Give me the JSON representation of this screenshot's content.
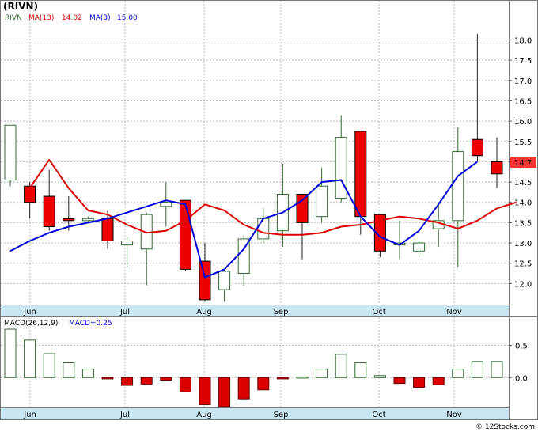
{
  "title": "(RIVN)",
  "legend": {
    "symbol": "RIVN",
    "ma13_label": "MA(13)",
    "ma13_value": "14.02",
    "ma3_label": "MA(3)",
    "ma3_value": "15.00"
  },
  "last_price_tag": "14.7",
  "macd_label": "MACD(26,12,9)",
  "macd_value_label": "MACD=0.25",
  "watermark": "© 12Stocks.com",
  "colors": {
    "up_body": "#ffffff",
    "up_edge": "#2f6a2f",
    "down_body": "#ee0000",
    "down_edge": "#000000",
    "ma13": "#dd0000",
    "ma3": "#0000dd",
    "axis_band": "#c9e6f3",
    "price_tag": "#ff3333",
    "macd_pos_edge": "#2f6a2f",
    "macd_neg_fill": "#dd0000"
  },
  "chart_data": [
    {
      "type": "candlestick",
      "months": [
        "Jun",
        "Jul",
        "Aug",
        "Sep",
        "Oct",
        "Nov"
      ],
      "y_ticks": [
        "12.0",
        "12.5",
        "13.0",
        "13.5",
        "14.0",
        "14.5",
        "15.0",
        "15.5",
        "16.0",
        "16.5",
        "17.0",
        "17.5",
        "18.0"
      ],
      "ylim": [
        11.5,
        18.4
      ],
      "grid": true,
      "candles": [
        {
          "o": 14.55,
          "h": 15.9,
          "l": 14.4,
          "c": 15.9
        },
        {
          "o": 14.4,
          "h": 14.5,
          "l": 13.6,
          "c": 14.0
        },
        {
          "o": 14.15,
          "h": 14.8,
          "l": 13.3,
          "c": 13.4
        },
        {
          "o": 13.6,
          "h": 14.15,
          "l": 13.3,
          "c": 13.55
        },
        {
          "o": 13.55,
          "h": 13.65,
          "l": 13.5,
          "c": 13.6
        },
        {
          "o": 13.6,
          "h": 13.8,
          "l": 12.85,
          "c": 13.05
        },
        {
          "o": 12.95,
          "h": 13.15,
          "l": 12.4,
          "c": 13.05
        },
        {
          "o": 12.85,
          "h": 13.75,
          "l": 11.95,
          "c": 13.7
        },
        {
          "o": 13.9,
          "h": 14.5,
          "l": 13.4,
          "c": 14.0
        },
        {
          "o": 14.05,
          "h": 14.05,
          "l": 12.3,
          "c": 12.35
        },
        {
          "o": 12.55,
          "h": 13.0,
          "l": 11.55,
          "c": 11.6
        },
        {
          "o": 11.85,
          "h": 12.35,
          "l": 11.55,
          "c": 12.3
        },
        {
          "o": 12.25,
          "h": 13.2,
          "l": 11.95,
          "c": 13.1
        },
        {
          "o": 13.1,
          "h": 13.85,
          "l": 13.0,
          "c": 13.6
        },
        {
          "o": 13.3,
          "h": 14.95,
          "l": 12.9,
          "c": 14.2
        },
        {
          "o": 14.2,
          "h": 14.2,
          "l": 12.6,
          "c": 13.5
        },
        {
          "o": 13.65,
          "h": 14.85,
          "l": 13.5,
          "c": 14.4
        },
        {
          "o": 14.1,
          "h": 16.15,
          "l": 14.0,
          "c": 15.6
        },
        {
          "o": 15.75,
          "h": 15.75,
          "l": 13.2,
          "c": 13.65
        },
        {
          "o": 13.7,
          "h": 13.7,
          "l": 12.65,
          "c": 12.8
        },
        {
          "o": 12.95,
          "h": 13.55,
          "l": 12.6,
          "c": 13.0
        },
        {
          "o": 12.8,
          "h": 13.05,
          "l": 12.65,
          "c": 13.0
        },
        {
          "o": 13.35,
          "h": 13.95,
          "l": 12.9,
          "c": 13.55
        },
        {
          "o": 13.55,
          "h": 15.85,
          "l": 12.4,
          "c": 15.25
        },
        {
          "o": 15.55,
          "h": 18.15,
          "l": 15.0,
          "c": 15.15
        },
        {
          "o": 15.0,
          "h": 15.6,
          "l": 14.35,
          "c": 14.7
        }
      ],
      "ma13": [
        14.35,
        15.05,
        14.35,
        13.8,
        13.7,
        13.45,
        13.25,
        13.3,
        13.55,
        13.95,
        13.8,
        13.45,
        13.25,
        13.2,
        13.2,
        13.25,
        13.4,
        13.45,
        13.55,
        13.65,
        13.6,
        13.5,
        13.35,
        13.55,
        13.85,
        14.0
      ],
      "ma13_start": 1,
      "ma3": [
        12.8,
        13.05,
        13.25,
        13.4,
        13.5,
        13.6,
        13.75,
        13.9,
        14.05,
        13.95,
        12.15,
        12.35,
        12.85,
        13.6,
        13.75,
        14.05,
        14.5,
        14.55,
        13.65,
        13.15,
        12.95,
        13.3,
        13.95,
        14.65,
        15.0
      ],
      "ma3_start": 0
    },
    {
      "type": "bar",
      "title": "MACD(26,12,9)",
      "y_ticks": [
        "0.5",
        "0.0"
      ],
      "ylim": [
        -0.45,
        0.75
      ],
      "values": [
        0.75,
        0.58,
        0.37,
        0.23,
        0.13,
        -0.02,
        -0.12,
        -0.1,
        -0.04,
        -0.22,
        -0.42,
        -0.45,
        -0.33,
        -0.19,
        -0.02,
        0.01,
        0.13,
        0.36,
        0.23,
        0.03,
        -0.09,
        -0.15,
        -0.11,
        0.13,
        0.25,
        0.25
      ]
    }
  ]
}
